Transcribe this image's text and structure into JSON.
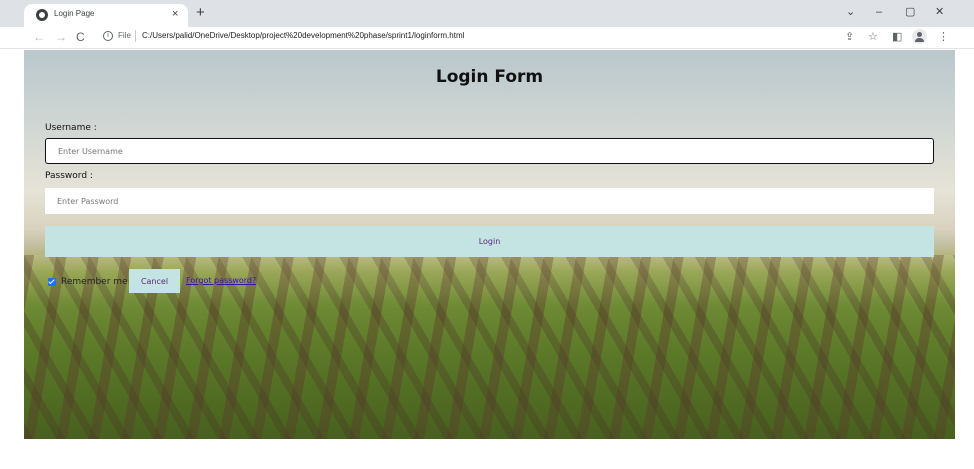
{
  "browser": {
    "tab_title": "Login Page",
    "tab_close": "×",
    "new_tab": "+",
    "window_controls": {
      "minimize": "–",
      "restore": "▢",
      "close": "✕",
      "tab_search": "⌄"
    },
    "nav": {
      "back": "←",
      "forward": "→",
      "reload": "C"
    },
    "omnibox": {
      "info_icon": "i",
      "scheme": "File",
      "url": "C:/Users/palid/OneDrive/Desktop/project%20development%20phase/sprint1/loginform.html"
    },
    "toolbar_icons": [
      "share-icon",
      "star-icon",
      "sidebar-icon",
      "profile-icon",
      "menu-icon"
    ]
  },
  "page": {
    "title": "Login Form",
    "username_label": "Username :",
    "username_placeholder": "Enter Username",
    "username_value": "",
    "password_label": "Password :",
    "password_placeholder": "Enter Password",
    "password_value": "",
    "login_button": "Login",
    "remember_label": "Remember me",
    "remember_checked": true,
    "cancel_button": "Cancel",
    "forgot_link": "Forgot password?"
  },
  "colors": {
    "button_bg": "#c4e3e3",
    "button_text": "#5b2b7b",
    "checkbox": "#1a73e8",
    "link": "#3a0fb0"
  }
}
